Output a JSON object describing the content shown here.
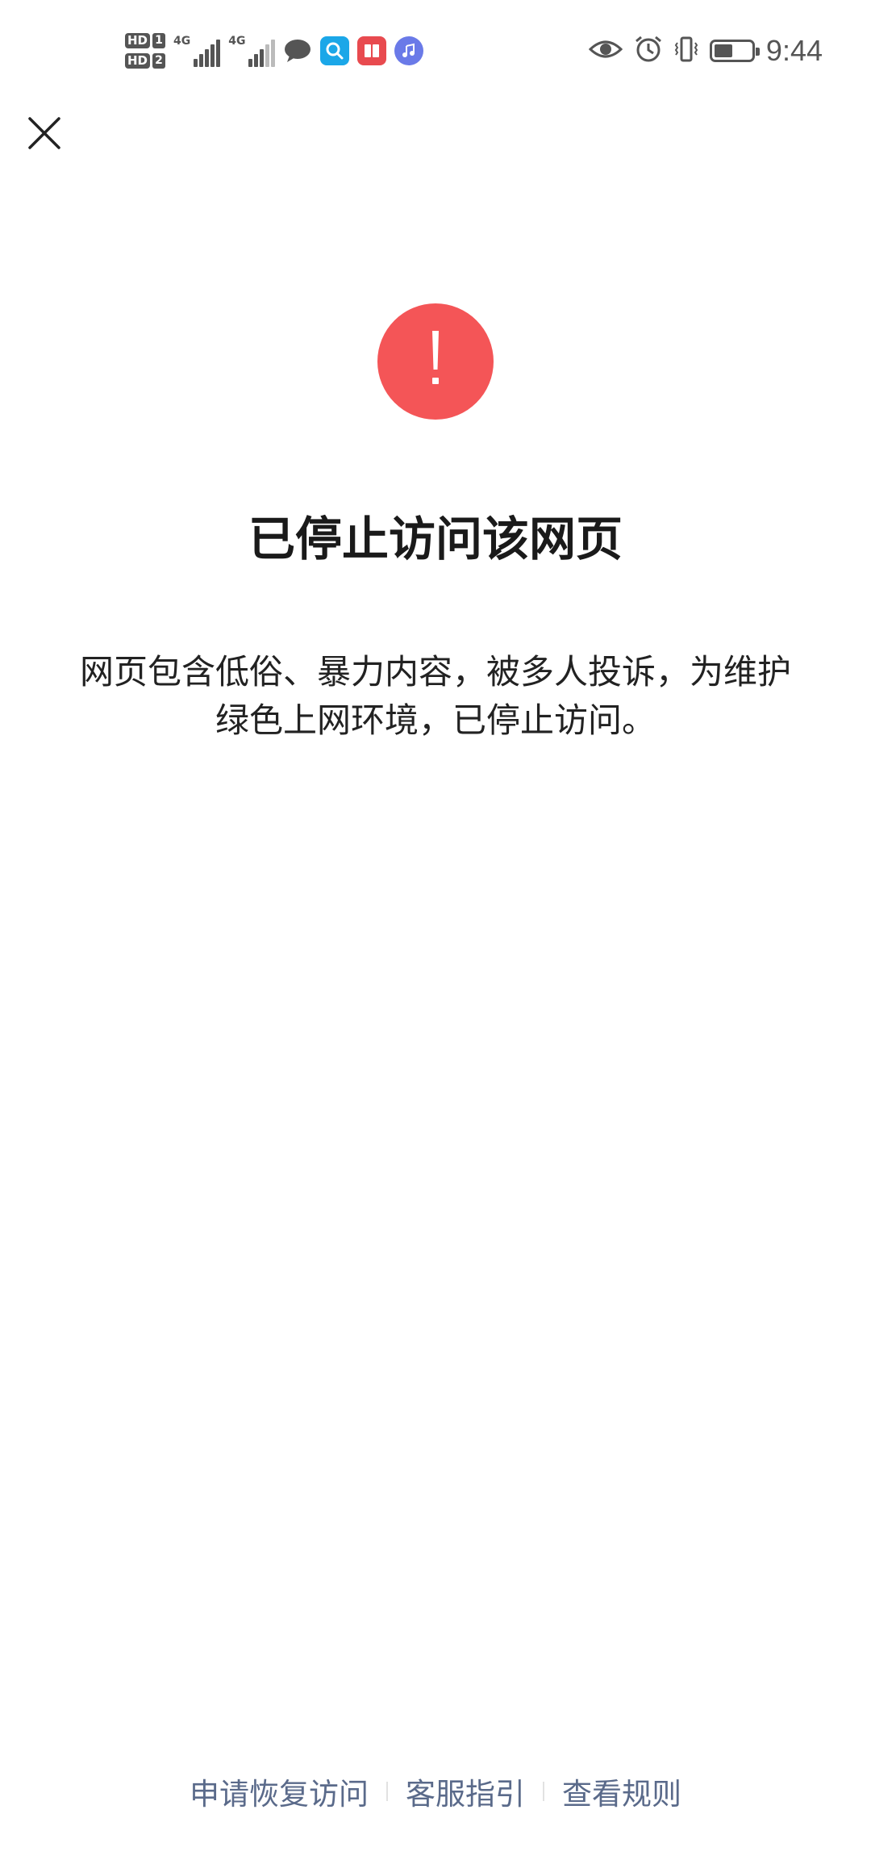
{
  "status_bar": {
    "sim1_label": "HD",
    "sim1_num": "1",
    "sim2_label": "HD",
    "sim2_num": "2",
    "network1": "4G",
    "network2": "4G",
    "time": "9:44",
    "battery_level": 0.5,
    "icons": [
      "message-icon",
      "search-app-icon",
      "book-app-icon",
      "music-app-icon",
      "eye-icon",
      "alarm-icon",
      "vibrate-icon",
      "battery-icon"
    ]
  },
  "page": {
    "close_icon": "close-icon",
    "warning_icon": "exclamation-icon",
    "warning_color": "#f45557",
    "title": "已停止访问该网页",
    "description": "网页包含低俗、暴力内容，被多人投诉，为维护绿色上网环境，已停止访问。"
  },
  "footer": {
    "links": [
      {
        "label": "申请恢复访问"
      },
      {
        "label": "客服指引"
      },
      {
        "label": "查看规则"
      }
    ],
    "link_color": "#5a6a8a"
  }
}
